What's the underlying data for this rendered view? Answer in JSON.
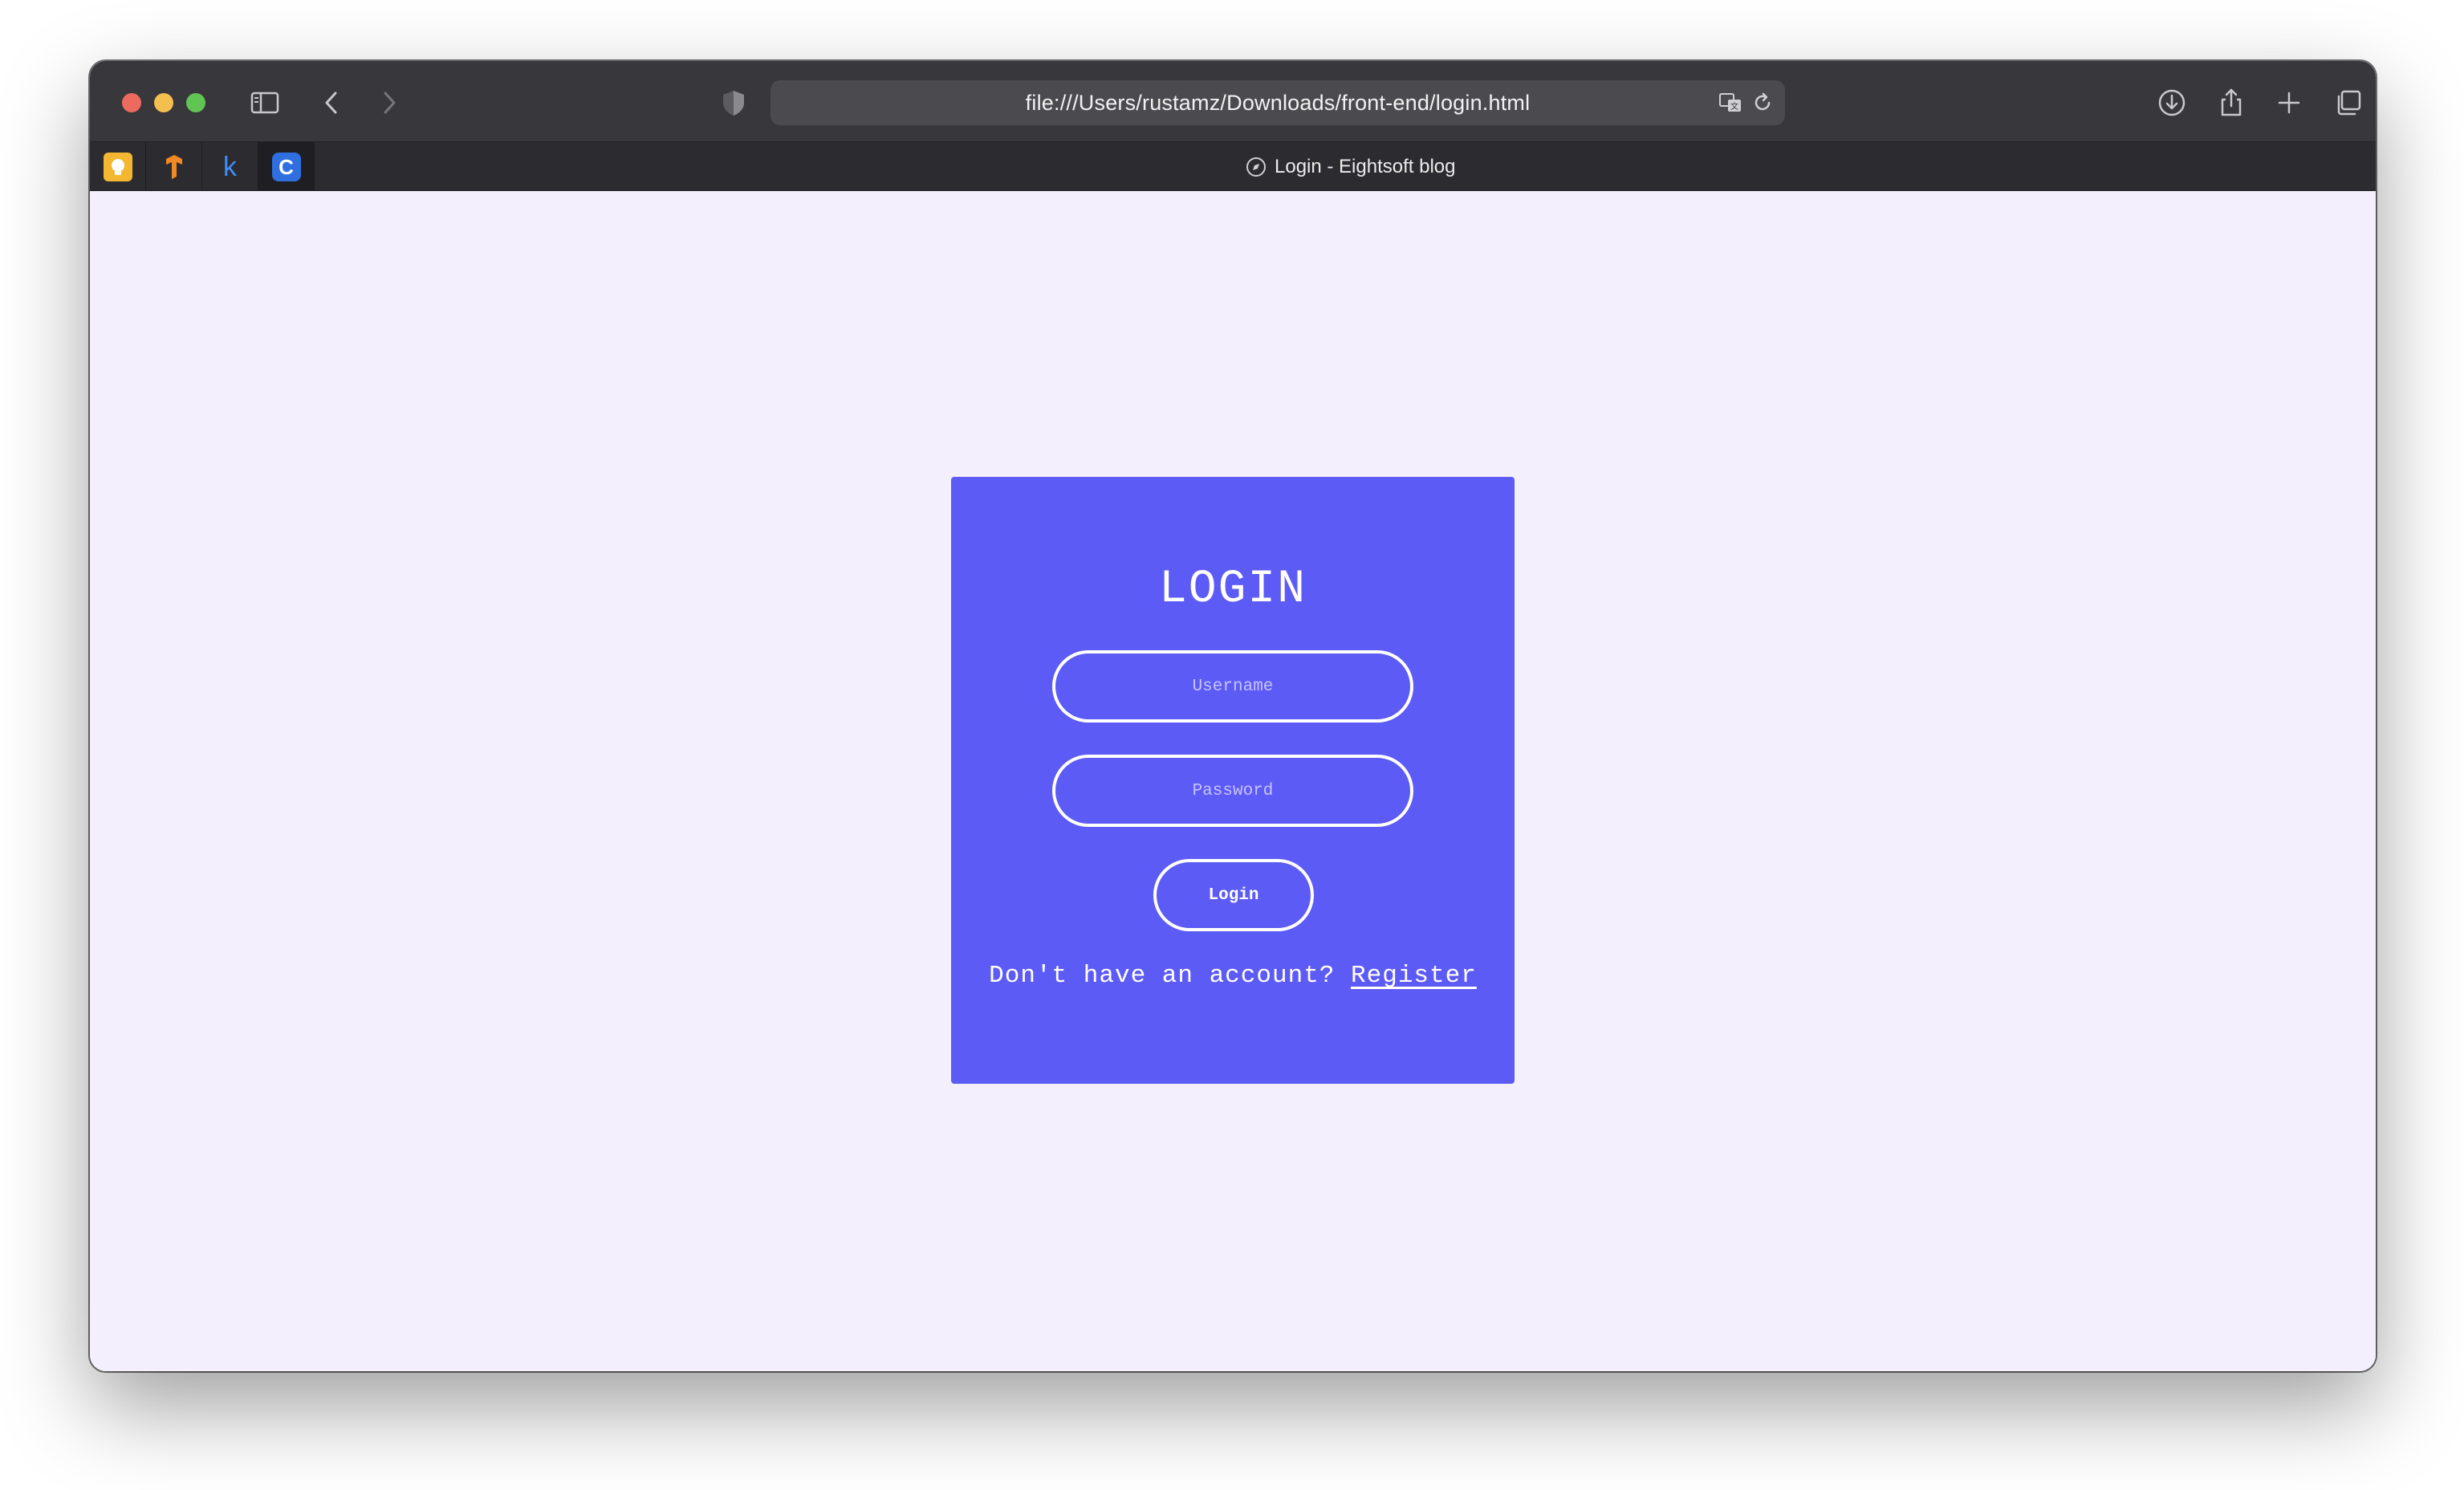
{
  "browser": {
    "url": "file:///Users/rustamz/Downloads/front-end/login.html",
    "tab_title": "Login - Eightsoft blog",
    "favorites": [
      {
        "name": "favorite-1",
        "glyph": "",
        "color": "#f5b731"
      },
      {
        "name": "favorite-2",
        "glyph": "",
        "color": "#f08a24"
      },
      {
        "name": "favorite-3",
        "glyph": "k",
        "color": "#3f8ef7"
      },
      {
        "name": "favorite-4",
        "glyph": "C",
        "color": "#2f6fe0"
      }
    ]
  },
  "login": {
    "title": "LOGIN",
    "username_placeholder": "Username",
    "password_placeholder": "Password",
    "button_label": "Login",
    "prompt_text": "Don't have an account? ",
    "register_link": "Register"
  },
  "colors": {
    "page_background": "#f3effc",
    "card_background": "#5d5bf5",
    "toolbar": "#38373b"
  }
}
